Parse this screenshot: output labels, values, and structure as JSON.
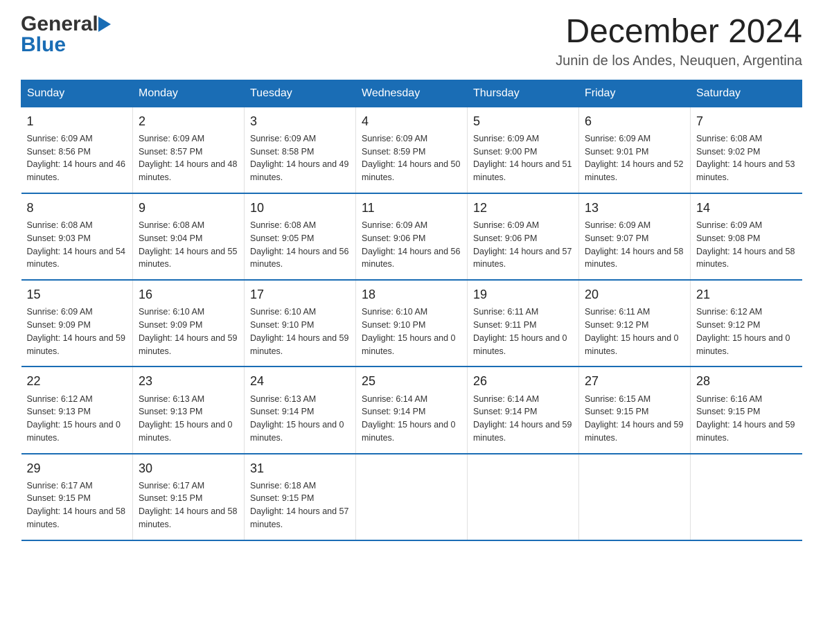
{
  "header": {
    "logo_general": "General",
    "logo_blue": "Blue",
    "month_title": "December 2024",
    "location": "Junin de los Andes, Neuquen, Argentina"
  },
  "days_of_week": [
    "Sunday",
    "Monday",
    "Tuesday",
    "Wednesday",
    "Thursday",
    "Friday",
    "Saturday"
  ],
  "weeks": [
    [
      {
        "day": "1",
        "sunrise": "Sunrise: 6:09 AM",
        "sunset": "Sunset: 8:56 PM",
        "daylight": "Daylight: 14 hours and 46 minutes."
      },
      {
        "day": "2",
        "sunrise": "Sunrise: 6:09 AM",
        "sunset": "Sunset: 8:57 PM",
        "daylight": "Daylight: 14 hours and 48 minutes."
      },
      {
        "day": "3",
        "sunrise": "Sunrise: 6:09 AM",
        "sunset": "Sunset: 8:58 PM",
        "daylight": "Daylight: 14 hours and 49 minutes."
      },
      {
        "day": "4",
        "sunrise": "Sunrise: 6:09 AM",
        "sunset": "Sunset: 8:59 PM",
        "daylight": "Daylight: 14 hours and 50 minutes."
      },
      {
        "day": "5",
        "sunrise": "Sunrise: 6:09 AM",
        "sunset": "Sunset: 9:00 PM",
        "daylight": "Daylight: 14 hours and 51 minutes."
      },
      {
        "day": "6",
        "sunrise": "Sunrise: 6:09 AM",
        "sunset": "Sunset: 9:01 PM",
        "daylight": "Daylight: 14 hours and 52 minutes."
      },
      {
        "day": "7",
        "sunrise": "Sunrise: 6:08 AM",
        "sunset": "Sunset: 9:02 PM",
        "daylight": "Daylight: 14 hours and 53 minutes."
      }
    ],
    [
      {
        "day": "8",
        "sunrise": "Sunrise: 6:08 AM",
        "sunset": "Sunset: 9:03 PM",
        "daylight": "Daylight: 14 hours and 54 minutes."
      },
      {
        "day": "9",
        "sunrise": "Sunrise: 6:08 AM",
        "sunset": "Sunset: 9:04 PM",
        "daylight": "Daylight: 14 hours and 55 minutes."
      },
      {
        "day": "10",
        "sunrise": "Sunrise: 6:08 AM",
        "sunset": "Sunset: 9:05 PM",
        "daylight": "Daylight: 14 hours and 56 minutes."
      },
      {
        "day": "11",
        "sunrise": "Sunrise: 6:09 AM",
        "sunset": "Sunset: 9:06 PM",
        "daylight": "Daylight: 14 hours and 56 minutes."
      },
      {
        "day": "12",
        "sunrise": "Sunrise: 6:09 AM",
        "sunset": "Sunset: 9:06 PM",
        "daylight": "Daylight: 14 hours and 57 minutes."
      },
      {
        "day": "13",
        "sunrise": "Sunrise: 6:09 AM",
        "sunset": "Sunset: 9:07 PM",
        "daylight": "Daylight: 14 hours and 58 minutes."
      },
      {
        "day": "14",
        "sunrise": "Sunrise: 6:09 AM",
        "sunset": "Sunset: 9:08 PM",
        "daylight": "Daylight: 14 hours and 58 minutes."
      }
    ],
    [
      {
        "day": "15",
        "sunrise": "Sunrise: 6:09 AM",
        "sunset": "Sunset: 9:09 PM",
        "daylight": "Daylight: 14 hours and 59 minutes."
      },
      {
        "day": "16",
        "sunrise": "Sunrise: 6:10 AM",
        "sunset": "Sunset: 9:09 PM",
        "daylight": "Daylight: 14 hours and 59 minutes."
      },
      {
        "day": "17",
        "sunrise": "Sunrise: 6:10 AM",
        "sunset": "Sunset: 9:10 PM",
        "daylight": "Daylight: 14 hours and 59 minutes."
      },
      {
        "day": "18",
        "sunrise": "Sunrise: 6:10 AM",
        "sunset": "Sunset: 9:10 PM",
        "daylight": "Daylight: 15 hours and 0 minutes."
      },
      {
        "day": "19",
        "sunrise": "Sunrise: 6:11 AM",
        "sunset": "Sunset: 9:11 PM",
        "daylight": "Daylight: 15 hours and 0 minutes."
      },
      {
        "day": "20",
        "sunrise": "Sunrise: 6:11 AM",
        "sunset": "Sunset: 9:12 PM",
        "daylight": "Daylight: 15 hours and 0 minutes."
      },
      {
        "day": "21",
        "sunrise": "Sunrise: 6:12 AM",
        "sunset": "Sunset: 9:12 PM",
        "daylight": "Daylight: 15 hours and 0 minutes."
      }
    ],
    [
      {
        "day": "22",
        "sunrise": "Sunrise: 6:12 AM",
        "sunset": "Sunset: 9:13 PM",
        "daylight": "Daylight: 15 hours and 0 minutes."
      },
      {
        "day": "23",
        "sunrise": "Sunrise: 6:13 AM",
        "sunset": "Sunset: 9:13 PM",
        "daylight": "Daylight: 15 hours and 0 minutes."
      },
      {
        "day": "24",
        "sunrise": "Sunrise: 6:13 AM",
        "sunset": "Sunset: 9:14 PM",
        "daylight": "Daylight: 15 hours and 0 minutes."
      },
      {
        "day": "25",
        "sunrise": "Sunrise: 6:14 AM",
        "sunset": "Sunset: 9:14 PM",
        "daylight": "Daylight: 15 hours and 0 minutes."
      },
      {
        "day": "26",
        "sunrise": "Sunrise: 6:14 AM",
        "sunset": "Sunset: 9:14 PM",
        "daylight": "Daylight: 14 hours and 59 minutes."
      },
      {
        "day": "27",
        "sunrise": "Sunrise: 6:15 AM",
        "sunset": "Sunset: 9:15 PM",
        "daylight": "Daylight: 14 hours and 59 minutes."
      },
      {
        "day": "28",
        "sunrise": "Sunrise: 6:16 AM",
        "sunset": "Sunset: 9:15 PM",
        "daylight": "Daylight: 14 hours and 59 minutes."
      }
    ],
    [
      {
        "day": "29",
        "sunrise": "Sunrise: 6:17 AM",
        "sunset": "Sunset: 9:15 PM",
        "daylight": "Daylight: 14 hours and 58 minutes."
      },
      {
        "day": "30",
        "sunrise": "Sunrise: 6:17 AM",
        "sunset": "Sunset: 9:15 PM",
        "daylight": "Daylight: 14 hours and 58 minutes."
      },
      {
        "day": "31",
        "sunrise": "Sunrise: 6:18 AM",
        "sunset": "Sunset: 9:15 PM",
        "daylight": "Daylight: 14 hours and 57 minutes."
      },
      null,
      null,
      null,
      null
    ]
  ]
}
